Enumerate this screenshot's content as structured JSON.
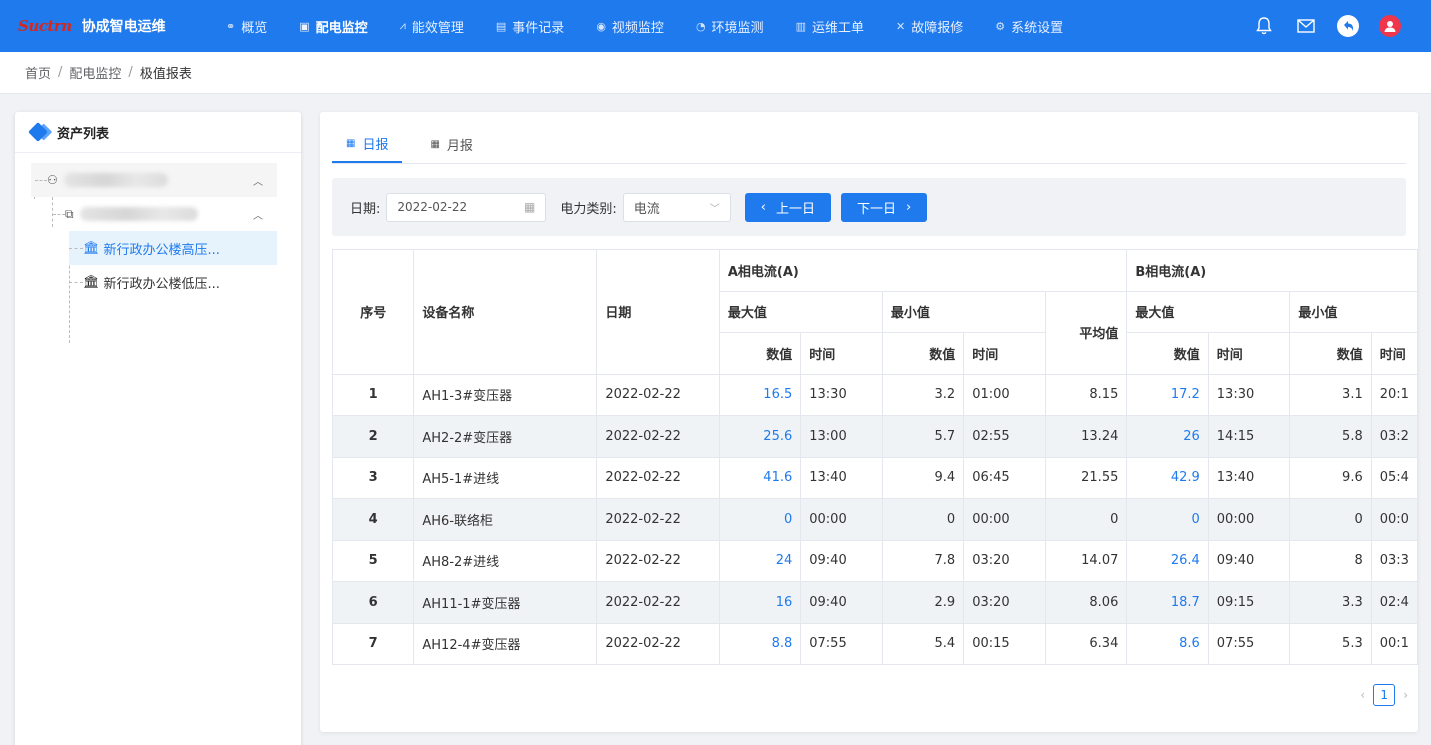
{
  "brand": {
    "logo": "Suctrn",
    "title": "协成智电运维"
  },
  "nav": [
    {
      "label": "概览",
      "icon": "link-icon"
    },
    {
      "label": "配电监控",
      "icon": "monitor-icon",
      "active": true
    },
    {
      "label": "能效管理",
      "icon": "chart-icon"
    },
    {
      "label": "事件记录",
      "icon": "record-icon"
    },
    {
      "label": "视频监控",
      "icon": "camera-icon"
    },
    {
      "label": "环境监测",
      "icon": "gauge-icon"
    },
    {
      "label": "运维工单",
      "icon": "ticket-icon"
    },
    {
      "label": "故障报修",
      "icon": "wrench-icon"
    },
    {
      "label": "系统设置",
      "icon": "gear-icon"
    }
  ],
  "breadcrumb": {
    "home": "首页",
    "section": "配电监控",
    "current": "极值报表"
  },
  "asset_panel": {
    "title": "资产列表",
    "leaf1": "新行政办公楼高压...",
    "leaf2": "新行政办公楼低压..."
  },
  "tabs": {
    "daily": "日报",
    "monthly": "月报"
  },
  "filter": {
    "date_label": "日期:",
    "date_value": "2022-02-22",
    "type_label": "电力类别:",
    "type_value": "电流",
    "prev_label": "上一日",
    "next_label": "下一日"
  },
  "table": {
    "h_index": "序号",
    "h_device": "设备名称",
    "h_date": "日期",
    "h_groupA": "A相电流(A)",
    "h_groupB": "B相电流(A)",
    "h_max": "最大值",
    "h_min": "最小值",
    "h_avg": "平均值",
    "h_value": "数值",
    "h_time": "时间",
    "rows": [
      [
        "1",
        "AH1-3#变压器",
        "2022-02-22",
        "16.5",
        "13:30",
        "3.2",
        "01:00",
        "8.15",
        "17.2",
        "13:30",
        "3.1",
        "20:1"
      ],
      [
        "2",
        "AH2-2#变压器",
        "2022-02-22",
        "25.6",
        "13:00",
        "5.7",
        "02:55",
        "13.24",
        "26",
        "14:15",
        "5.8",
        "03:2"
      ],
      [
        "3",
        "AH5-1#进线",
        "2022-02-22",
        "41.6",
        "13:40",
        "9.4",
        "06:45",
        "21.55",
        "42.9",
        "13:40",
        "9.6",
        "05:4"
      ],
      [
        "4",
        "AH6-联络柜",
        "2022-02-22",
        "0",
        "00:00",
        "0",
        "00:00",
        "0",
        "0",
        "00:00",
        "0",
        "00:0"
      ],
      [
        "5",
        "AH8-2#进线",
        "2022-02-22",
        "24",
        "09:40",
        "7.8",
        "03:20",
        "14.07",
        "26.4",
        "09:40",
        "8",
        "03:3"
      ],
      [
        "6",
        "AH11-1#变压器",
        "2022-02-22",
        "16",
        "09:40",
        "2.9",
        "03:20",
        "8.06",
        "18.7",
        "09:15",
        "3.3",
        "02:4"
      ],
      [
        "7",
        "AH12-4#变压器",
        "2022-02-22",
        "8.8",
        "07:55",
        "5.4",
        "00:15",
        "6.34",
        "8.6",
        "07:55",
        "5.3",
        "00:1"
      ]
    ]
  },
  "pager": {
    "current": "1"
  }
}
